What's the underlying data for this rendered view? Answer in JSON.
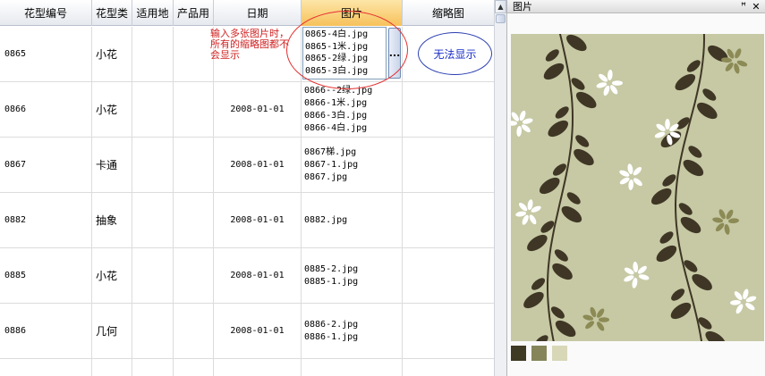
{
  "columns": [
    "花型编号",
    "花型类",
    "适用地",
    "产品用",
    "日期",
    "图片",
    "缩略图"
  ],
  "rows": [
    {
      "code": "0865",
      "type": "小花",
      "place": "",
      "product": "",
      "date": "",
      "files": []
    },
    {
      "code": "0866",
      "type": "小花",
      "place": "",
      "product": "",
      "date": "2008-01-01",
      "files": [
        "0866--2绿.jpg",
        "0866-1米.jpg",
        "0866-3白.jpg",
        "0866-4白.jpg"
      ]
    },
    {
      "code": "0867",
      "type": "卡通",
      "place": "",
      "product": "",
      "date": "2008-01-01",
      "files": [
        "0867梯.jpg",
        "0867-1.jpg",
        "0867.jpg"
      ]
    },
    {
      "code": "0882",
      "type": "抽象",
      "place": "",
      "product": "",
      "date": "2008-01-01",
      "files": [
        "0882.jpg"
      ]
    },
    {
      "code": "0885",
      "type": "小花",
      "place": "",
      "product": "",
      "date": "2008-01-01",
      "files": [
        "0885-2.jpg",
        "0885-1.jpg"
      ]
    },
    {
      "code": "0886",
      "type": "几何",
      "place": "",
      "product": "",
      "date": "2008-01-01",
      "files": [
        "0886-2.jpg",
        "0886-1.jpg"
      ]
    }
  ],
  "editor": {
    "lines": [
      "0865-4白.jpg",
      "0865-1米.jpg",
      "0865-2绿.jpg",
      "0865-3白.jpg"
    ],
    "button": "..."
  },
  "annotation": {
    "note": "输入多张图片时，所有的缩略图都不会显示",
    "thumb_status": "无法显示"
  },
  "scroll": {
    "up_arrow": "▲"
  },
  "panel": {
    "title": "图片",
    "pin": "ꟸ",
    "close": "✕"
  },
  "colors": {
    "pattern_bg": "#c6c9a4",
    "leaf_dark": "#3f3625",
    "leaf_olive": "#8c8a55",
    "leaf_white": "#ffffff",
    "annotation_red": "#e53030",
    "annotation_blue": "#2a3fb0"
  },
  "swatches": [
    "#3f3a24",
    "#86855a",
    "#d8d7b8"
  ]
}
